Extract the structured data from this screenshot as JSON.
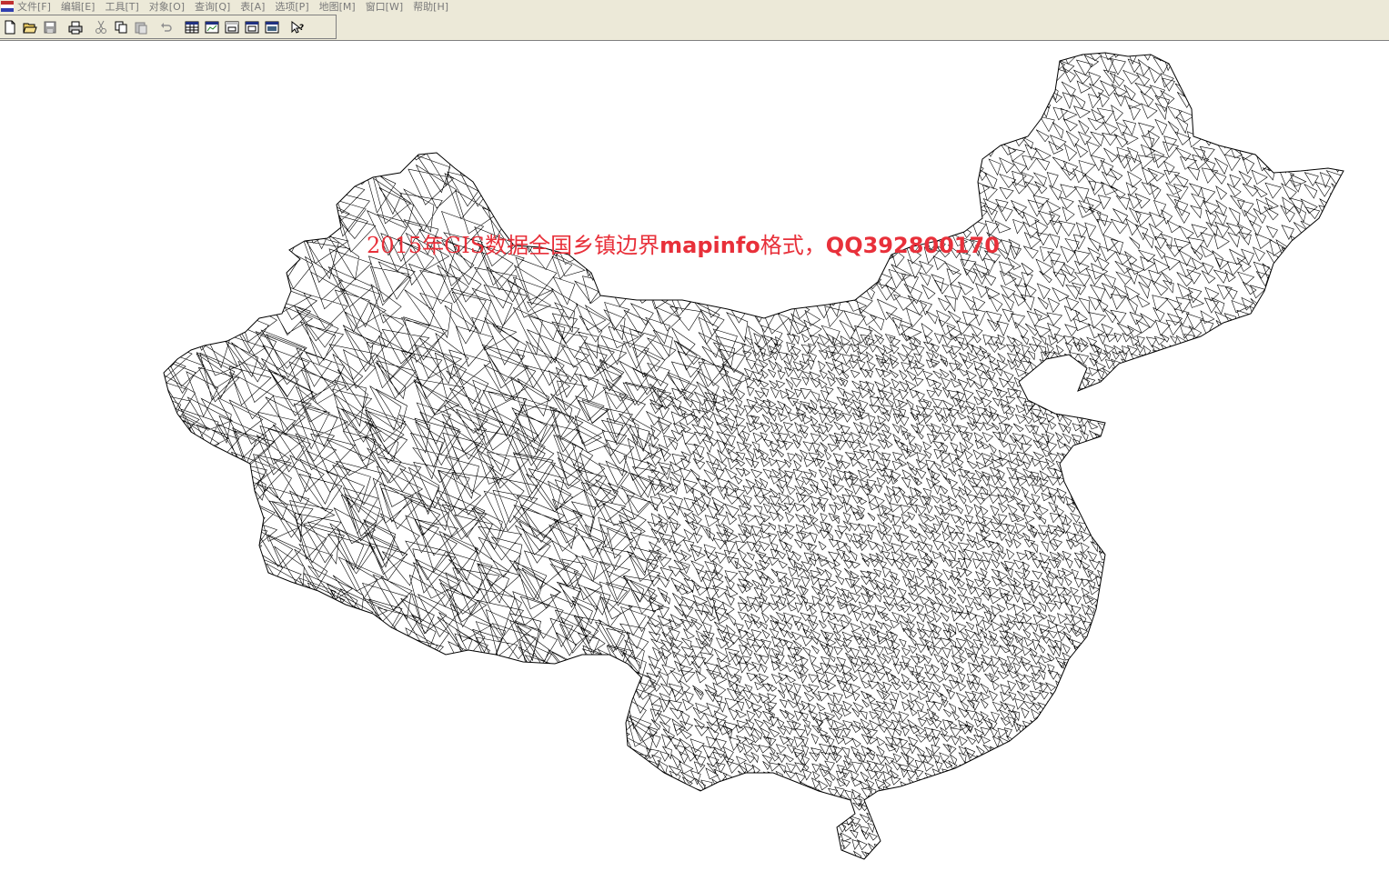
{
  "menubar": {
    "items": [
      "文件[F]",
      "编辑[E]",
      "工具[T]",
      "对象[O]",
      "查询[Q]",
      "表[A]",
      "选项[P]",
      "地图[M]",
      "窗口[W]",
      "帮助[H]"
    ]
  },
  "toolbar": {
    "buttons": [
      "new-icon",
      "open-icon",
      "save-icon",
      "print-icon",
      "cut-icon",
      "copy-icon",
      "paste-icon",
      "undo-icon",
      "browser-icon",
      "map-window-icon",
      "graph-icon",
      "layout-icon",
      "redistrict-icon",
      "help-pointer-icon"
    ]
  },
  "watermark": {
    "part1": "2015年GIS",
    "part2": "数据全国乡镇边界",
    "part3": "mapinfo",
    "part4": "格式，",
    "part5": "QQ392800170"
  },
  "colors": {
    "watermark": "#e8303a",
    "chrome": "#ece9d8",
    "map_line": "#000000"
  }
}
